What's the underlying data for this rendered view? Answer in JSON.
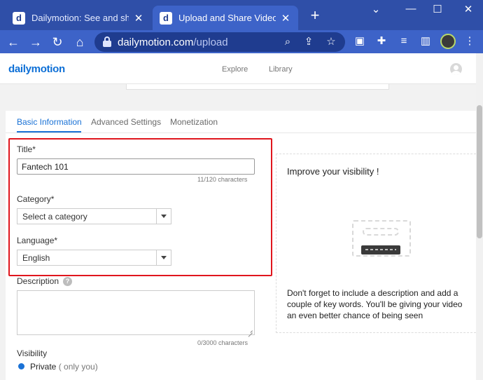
{
  "browser": {
    "tabs": [
      {
        "title": "Dailymotion: See and share t",
        "favicon": "d"
      },
      {
        "title": "Upload and Share Videos | D",
        "favicon": "d",
        "active": true
      }
    ],
    "new_tab": "+",
    "url_domain": "dailymotion.com",
    "url_path": "/upload"
  },
  "site": {
    "logo": "dailymotion",
    "nav": [
      "Explore",
      "Library"
    ]
  },
  "form": {
    "tabs": [
      "Basic Information",
      "Advanced Settings",
      "Monetization"
    ],
    "title_label": "Title",
    "title_value": "Fantech 101",
    "title_counter": "11/120 characters",
    "category_label": "Category",
    "category_value": "Select a category",
    "language_label": "Language",
    "language_value": "English",
    "description_label": "Description",
    "description_counter": "0/3000 characters",
    "visibility_label": "Visibility",
    "visibility_option": "Private",
    "visibility_note": "( only you)",
    "required_mark": "*"
  },
  "sidebar": {
    "title": "Improve your visibility !",
    "text": "Don't forget to include a description and add a couple of key words. You'll be giving your video an even better chance of being seen"
  },
  "colors": {
    "browser_tabstrip": "#2f4fa8",
    "browser_toolbar": "#3d63c8",
    "accent": "#1a72d6",
    "highlight": "#e0161d"
  }
}
